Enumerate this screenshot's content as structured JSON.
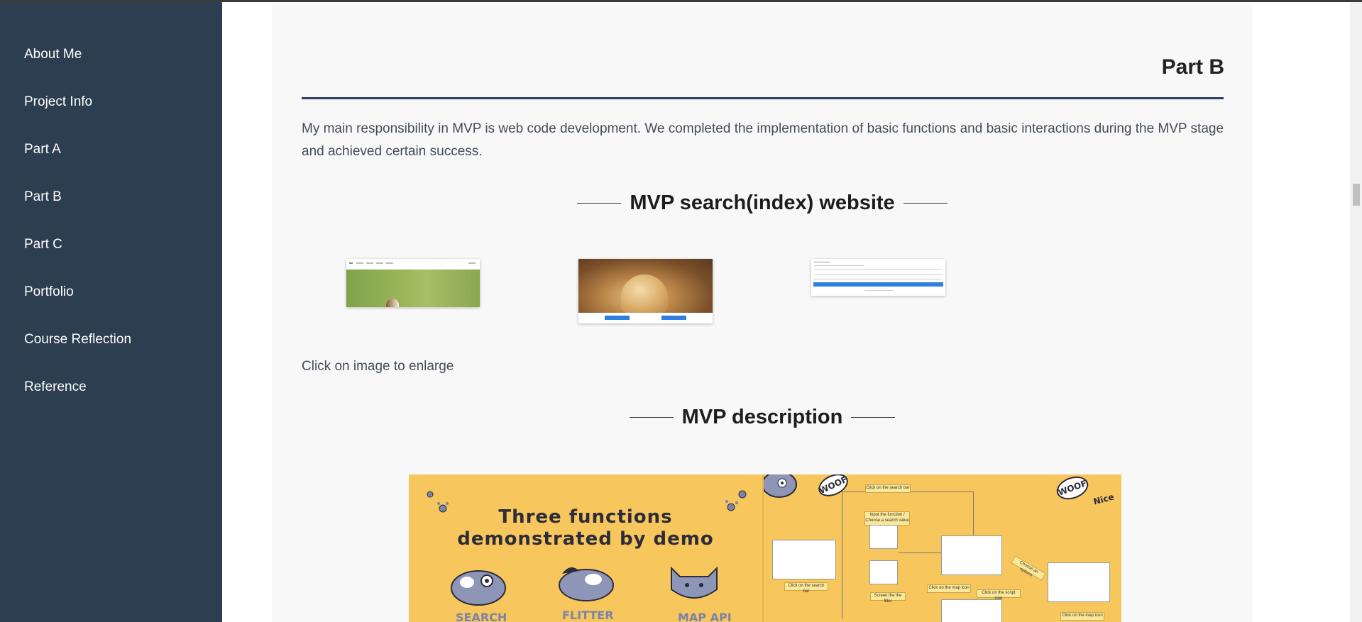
{
  "sidebar": {
    "items": [
      {
        "label": "About Me"
      },
      {
        "label": "Project Info"
      },
      {
        "label": "Part A"
      },
      {
        "label": "Part B"
      },
      {
        "label": "Part C"
      },
      {
        "label": "Portfolio"
      },
      {
        "label": "Course Reflection"
      },
      {
        "label": "Reference"
      }
    ]
  },
  "main": {
    "part_title": "Part B",
    "intro": "My main responsibility in MVP is web code development. We completed the implementation of basic functions and basic interactions during the MVP stage and achieved certain success.",
    "section1_heading": "MVP search(index) website",
    "enlarge_hint": "Click on image to enlarge",
    "section2_heading": "MVP description"
  },
  "banner": {
    "headline_line1": "Three functions",
    "headline_line2": "demonstrated by demo",
    "labels": [
      "SEARCH",
      "FLITTER",
      "MAP API"
    ],
    "woof1": "WOOF",
    "woof2": "WOOF",
    "nice": "Nice",
    "flow": {
      "click_search_bar": "Click on the search bar",
      "input_function": "Input the function / Choose a search value",
      "click_search_bar_2": "Click on the search bar",
      "screen_filter": "Screen the the filter",
      "click_map_icon": "Click on the map icon",
      "click_script_icon": "Click on the script icon",
      "choose_options": "Choose an options",
      "click_map_icon_2": "Click on the map icon"
    }
  },
  "colors": {
    "sidebar_bg": "#2d3e50",
    "banner_bg": "#f7c65c",
    "accent_rule": "#2d3e6e"
  }
}
